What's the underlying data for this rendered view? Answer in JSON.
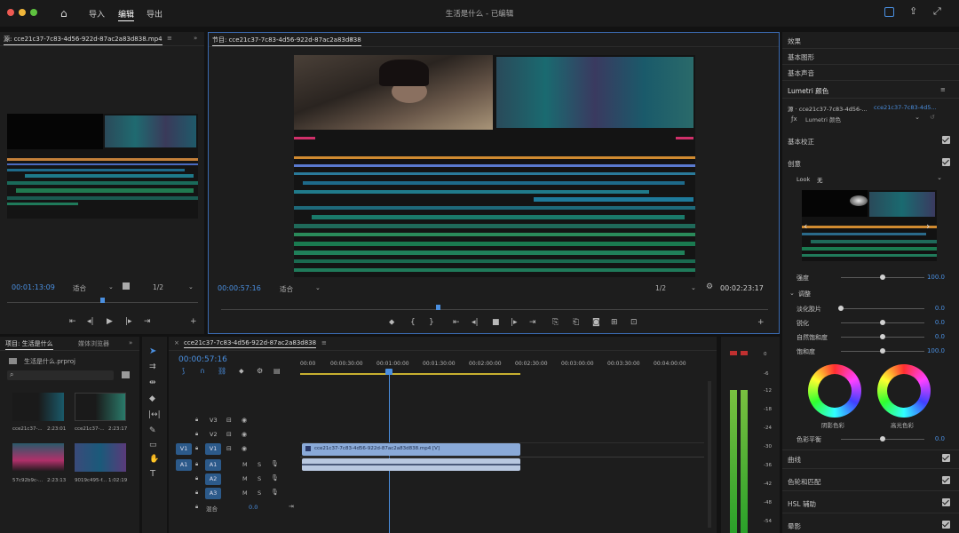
{
  "window": {
    "title": "生活是什么 - 已编辑",
    "nav": [
      "导入",
      "编辑",
      "导出"
    ],
    "active_nav": "编辑"
  },
  "source": {
    "tab": "源: cce21c37-7c83-4d56-922d-87ac2a83d838.mp4",
    "timecode": "00:01:13:09",
    "fit": "适合",
    "res": "1/2"
  },
  "program": {
    "tab": "节目: cce21c37-7c83-4d56-922d-87ac2a83d838",
    "timecode": "00:00:57:16",
    "fit": "适合",
    "res": "1/2",
    "duration": "00:02:23:17"
  },
  "project": {
    "tabs": [
      "项目: 生活是什么",
      "媒体浏览器"
    ],
    "file": "生活是什么.prproj",
    "clips": [
      {
        "name": "cce21c37-...",
        "dur": "2:23:01"
      },
      {
        "name": "cce21c37-...",
        "dur": "2:23:17"
      },
      {
        "name": "57c92b9c-...",
        "dur": "2:23:13"
      },
      {
        "name": "9019c495-f...",
        "dur": "1:02:19"
      }
    ]
  },
  "timeline": {
    "tab": "cce21c37-7c83-4d56-922d-87ac2a83d838",
    "timecode": "00:00:57:16",
    "ruler": [
      "00:00",
      "00:00:30:00",
      "00:01:00:00",
      "00:01:30:00",
      "00:02:00:00",
      "00:02:30:00",
      "00:03:00:00",
      "00:03:30:00",
      "00:04:00:00"
    ],
    "video_tracks": [
      "V3",
      "V2",
      "V1"
    ],
    "audio_tracks": [
      "A1",
      "A2",
      "A3"
    ],
    "src_v": "V1",
    "src_a": "A1",
    "mix_label": "混合",
    "mix_val": "0.0",
    "clip_label": "cce21c37-7c83-4d56-922d-87ac2a83d838.mp4 [V]",
    "m": "M",
    "s": "S"
  },
  "meter": {
    "ticks": [
      "0",
      "-6",
      "-12",
      "-18",
      "-24",
      "-30",
      "-36",
      "-42",
      "-48",
      "-54"
    ]
  },
  "right": {
    "sections": [
      "效果",
      "基本图形",
      "基本声音",
      "Lumetri 颜色"
    ],
    "source_label": "源 · cce21c37-7c83-4d56-...",
    "source_link": "cce21c37-7c83-4d5...",
    "lumetri_select": "Lumetri 颜色",
    "basic": "基本校正",
    "creative": "创意",
    "look_label": "Look",
    "look_val": "无",
    "intensity": {
      "label": "强度",
      "val": "100.0",
      "frac": 0.5
    },
    "adjust": "调整",
    "sliders": [
      {
        "label": "淡化胶片",
        "val": "0.0",
        "frac": 0.0
      },
      {
        "label": "锐化",
        "val": "0.0",
        "frac": 0.5
      },
      {
        "label": "自然饱和度",
        "val": "0.0",
        "frac": 0.5
      },
      {
        "label": "饱和度",
        "val": "100.0",
        "frac": 0.5
      }
    ],
    "wheel_shadow": "阴影色彩",
    "wheel_highlight": "高光色彩",
    "balance": {
      "label": "色彩平衡",
      "val": "0.0",
      "frac": 0.5
    },
    "bottom": [
      "曲线",
      "色轮和匹配",
      "HSL 辅助",
      "晕影"
    ]
  }
}
